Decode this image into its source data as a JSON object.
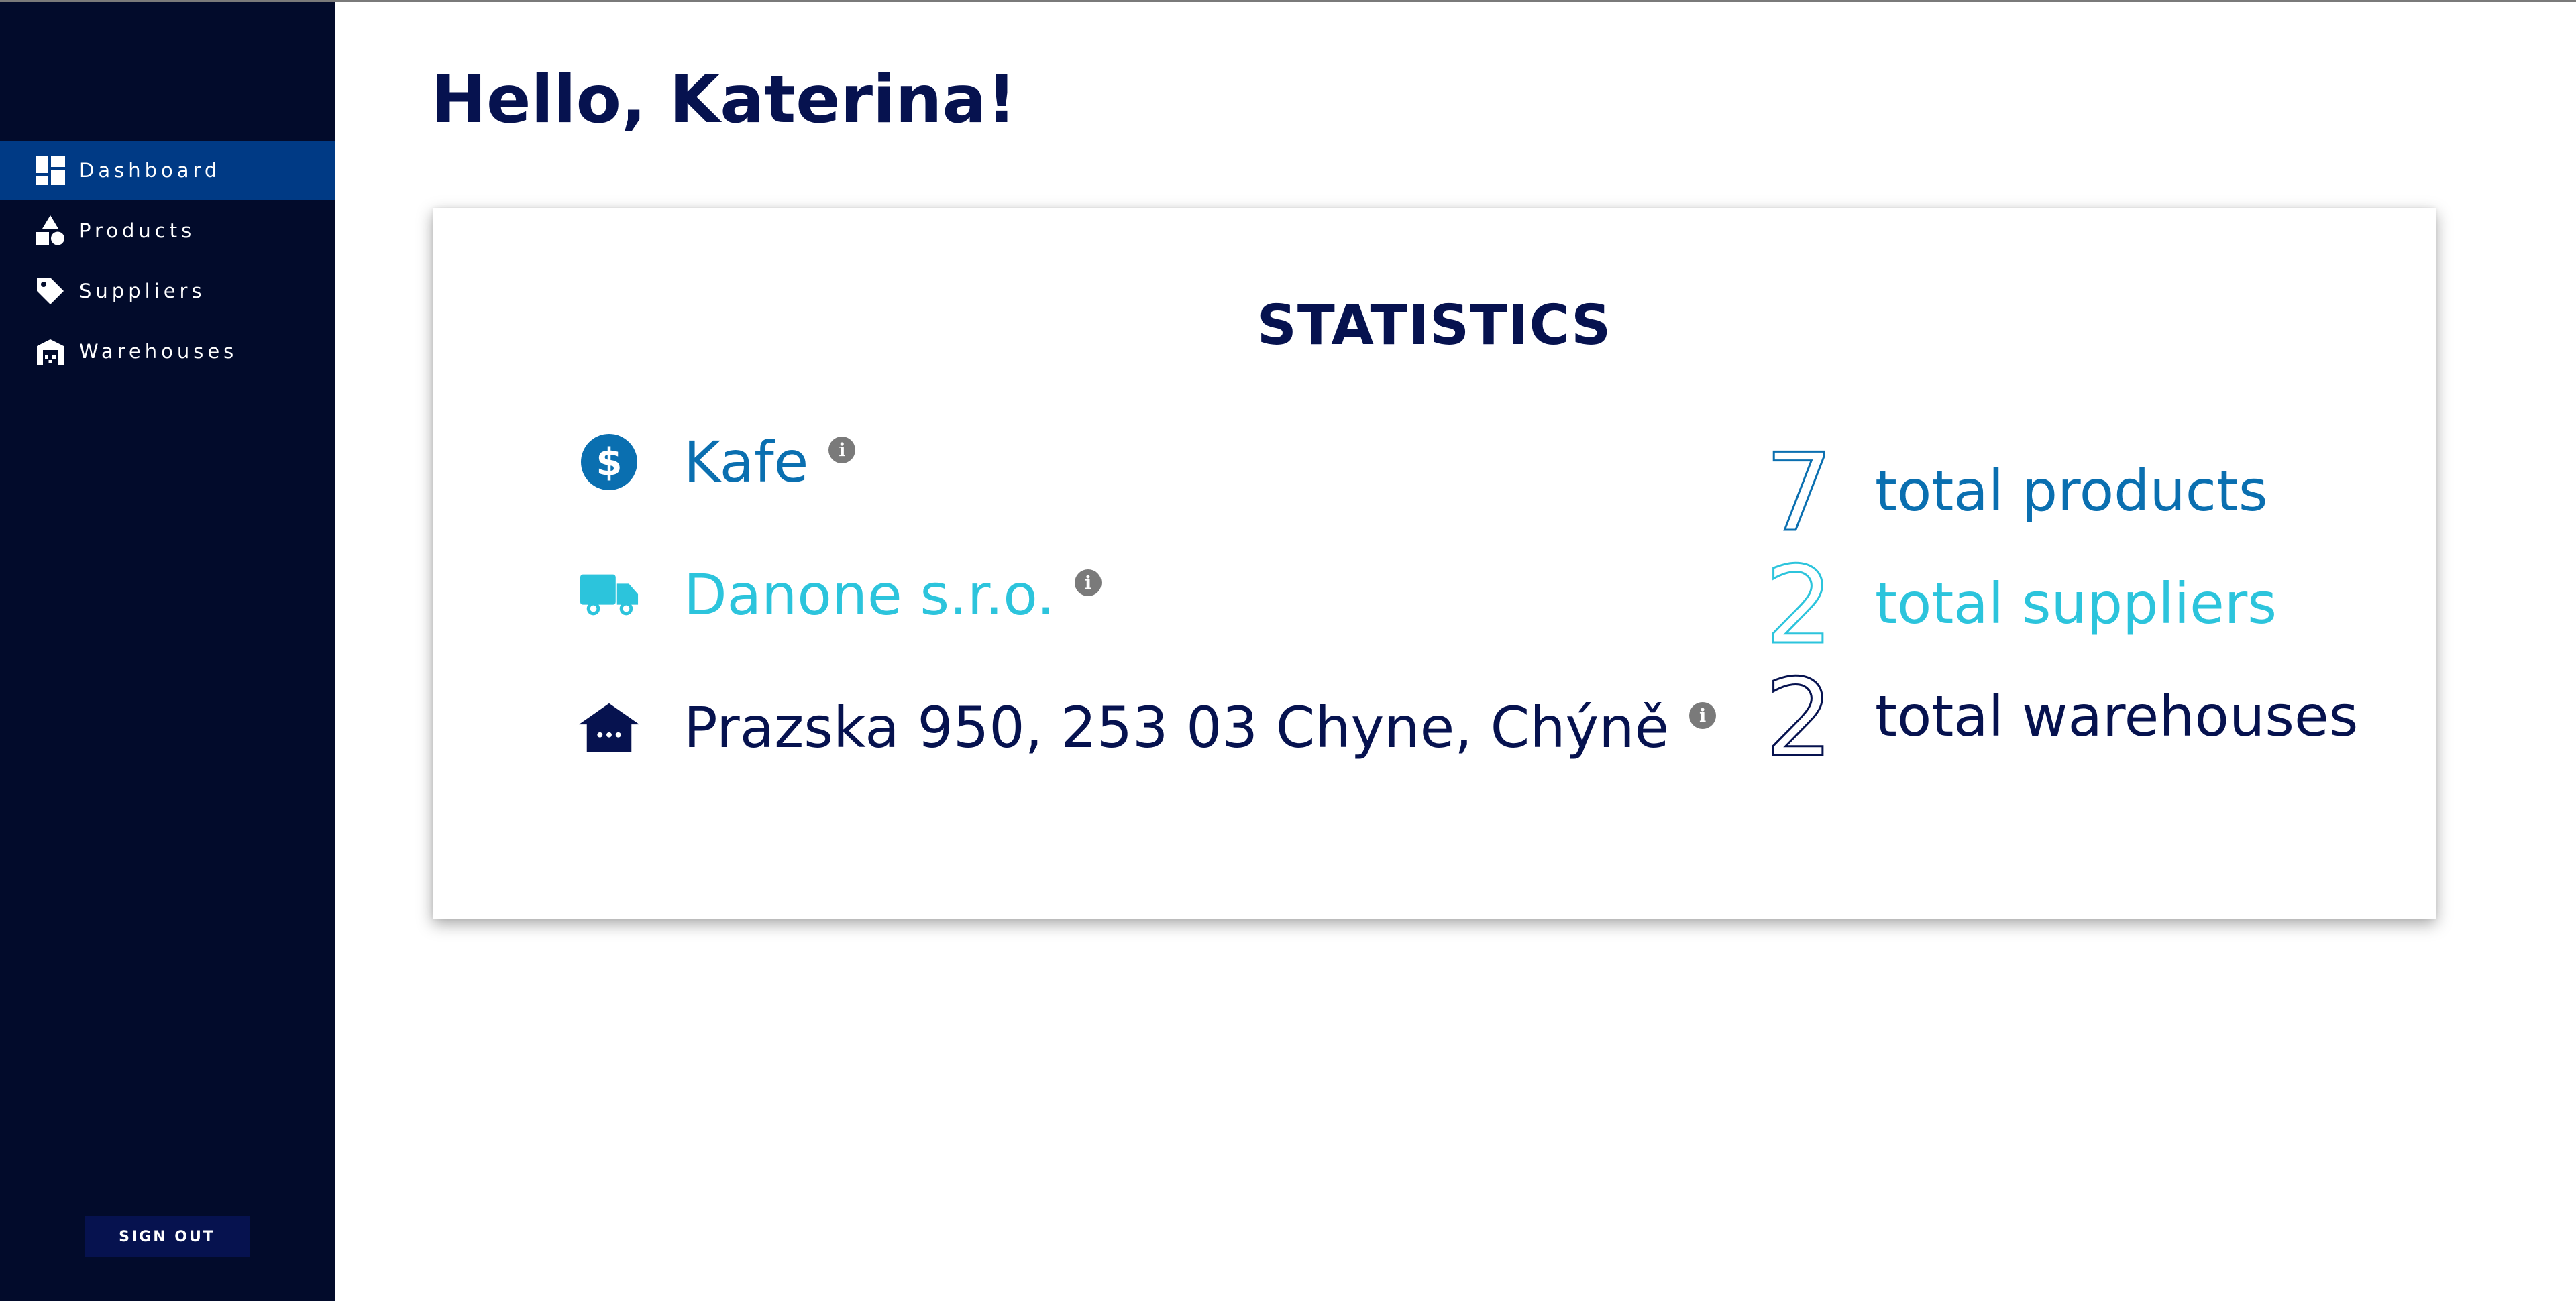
{
  "sidebar": {
    "items": [
      {
        "label": "Dashboard",
        "icon": "dashboard-icon",
        "active": true
      },
      {
        "label": "Products",
        "icon": "shapes-icon",
        "active": false
      },
      {
        "label": "Suppliers",
        "icon": "tag-icon",
        "active": false
      },
      {
        "label": "Warehouses",
        "icon": "warehouse-icon",
        "active": false
      }
    ],
    "sign_out_label": "SIGN OUT"
  },
  "main": {
    "greeting": "Hello, Katerina!"
  },
  "statistics": {
    "title": "STATISTICS",
    "top_product": {
      "text": "Kafe",
      "icon": "dollar-circle-icon",
      "color": "#0a6fb0"
    },
    "top_supplier": {
      "text": "Danone s.r.o.",
      "icon": "truck-icon",
      "color": "#2cc4dc"
    },
    "top_warehouse": {
      "text": "Prazska 950, 253 03 Chyne, Chýně",
      "icon": "warehouse-icon",
      "color": "#06124f"
    },
    "info_glyph": "i",
    "counts": [
      {
        "value": "7",
        "label": "total products",
        "color": "#0a6fb0"
      },
      {
        "value": "2",
        "label": "total suppliers",
        "color": "#2cc4dc"
      },
      {
        "value": "2",
        "label": "total warehouses",
        "color": "#06124f"
      }
    ]
  },
  "colors": {
    "sidebar_bg": "#020b2b",
    "active_item_bg": "#003a85",
    "navy": "#06124f",
    "blue": "#0a6fb0",
    "cyan": "#2cc4dc",
    "info_grey": "#7a7a7a"
  }
}
